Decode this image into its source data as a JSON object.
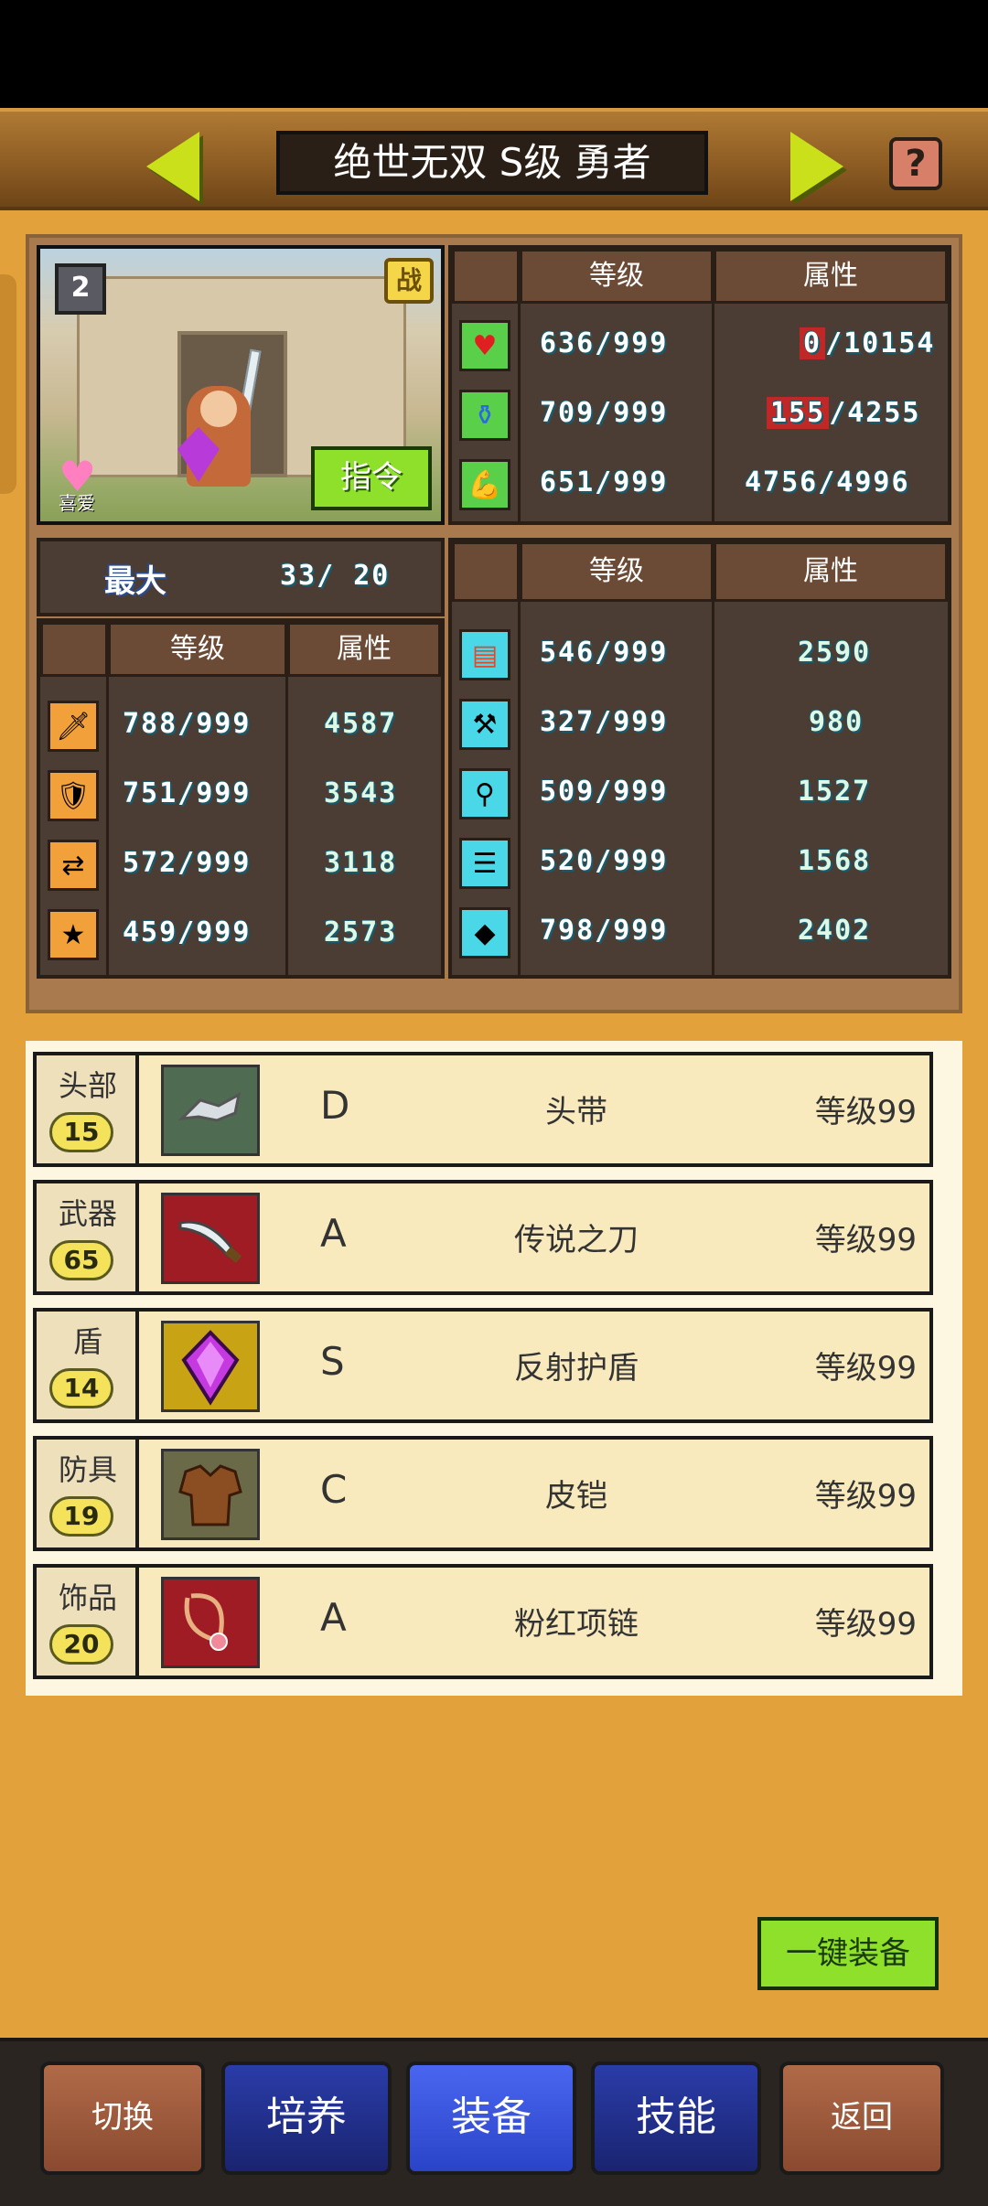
{
  "header": {
    "title": "绝世无双 S级 勇者"
  },
  "portrait": {
    "rank": "2",
    "battle_badge": "战",
    "favorite_label": "喜爱",
    "command_button": "指令"
  },
  "resource_table": {
    "col_level": "等级",
    "col_attr": "属性",
    "rows": [
      {
        "icon": "heart-icon",
        "level": "636/999",
        "attr_current": "0",
        "attr_max": "/10154"
      },
      {
        "icon": "potion-icon",
        "level": "709/999",
        "attr_current": "155",
        "attr_max": "/4255"
      },
      {
        "icon": "stamina-icon",
        "level": "651/999",
        "attr_current": "4756",
        "attr_max": "/4996"
      }
    ]
  },
  "level_row": {
    "label": "最大",
    "value": "33/ 20"
  },
  "combat_table": {
    "col_level": "等级",
    "col_attr": "属性",
    "rows": [
      {
        "icon": "sword-icon",
        "level": "788/999",
        "attr": "4587"
      },
      {
        "icon": "shield-icon",
        "level": "751/999",
        "attr": "3543"
      },
      {
        "icon": "speed-icon",
        "level": "572/999",
        "attr": "3118"
      },
      {
        "icon": "star-icon",
        "level": "459/999",
        "attr": "2573"
      }
    ]
  },
  "work_table": {
    "col_level": "等级",
    "col_attr": "属性",
    "rows": [
      {
        "icon": "book-icon",
        "level": "546/999",
        "attr": "2590"
      },
      {
        "icon": "hammer-icon",
        "level": "327/999",
        "attr": "980"
      },
      {
        "icon": "shovel-icon",
        "level": "509/999",
        "attr": "1527"
      },
      {
        "icon": "chest-icon",
        "level": "520/999",
        "attr": "1568"
      },
      {
        "icon": "crystal-icon",
        "level": "798/999",
        "attr": "2402"
      }
    ]
  },
  "equipment": [
    {
      "slot": "头部",
      "slot_level": "15",
      "grade": "D",
      "name": "头带",
      "level": "等级99",
      "icon": "headband-icon",
      "icon_bg": "#4f6b52"
    },
    {
      "slot": "武器",
      "slot_level": "65",
      "grade": "A",
      "name": "传说之刀",
      "level": "等级99",
      "icon": "blade-icon",
      "icon_bg": "#a01c24"
    },
    {
      "slot": "盾",
      "slot_level": "14",
      "grade": "S",
      "name": "反射护盾",
      "level": "等级99",
      "icon": "gem-shield-icon",
      "icon_bg": "#c8a414"
    },
    {
      "slot": "防具",
      "slot_level": "19",
      "grade": "C",
      "name": "皮铠",
      "level": "等级99",
      "icon": "leather-armor-icon",
      "icon_bg": "#6b6a48"
    },
    {
      "slot": "饰品",
      "slot_level": "20",
      "grade": "A",
      "name": "粉红项链",
      "level": "等级99",
      "icon": "necklace-icon",
      "icon_bg": "#a01c24"
    }
  ],
  "equip_all_button": "一键装备",
  "bottom_nav": {
    "switch": "切换",
    "train": "培养",
    "equip": "装备",
    "skills": "技能",
    "back": "返回"
  }
}
